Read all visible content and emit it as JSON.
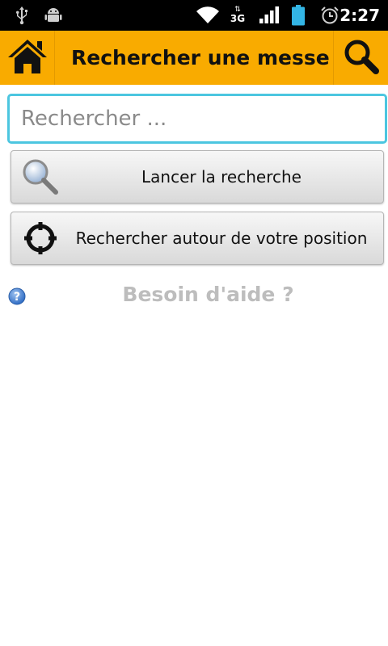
{
  "status_bar": {
    "time": "2:27",
    "network": "3G",
    "icons": [
      "usb-icon",
      "android-debug-icon",
      "wifi-icon",
      "network-3g-icon",
      "signal-icon",
      "battery-icon",
      "alarm-icon"
    ]
  },
  "action_bar": {
    "title": "Rechercher une messe",
    "home_icon": "home-icon",
    "search_icon": "search-icon",
    "background": "#f9ab00"
  },
  "search": {
    "placeholder": "Rechercher ...",
    "value": "",
    "focus_color": "#4cc6e0"
  },
  "buttons": {
    "launch_search": "Lancer la recherche",
    "search_around": "Rechercher autour de votre position"
  },
  "help": {
    "label": "Besoin d'aide ?"
  }
}
